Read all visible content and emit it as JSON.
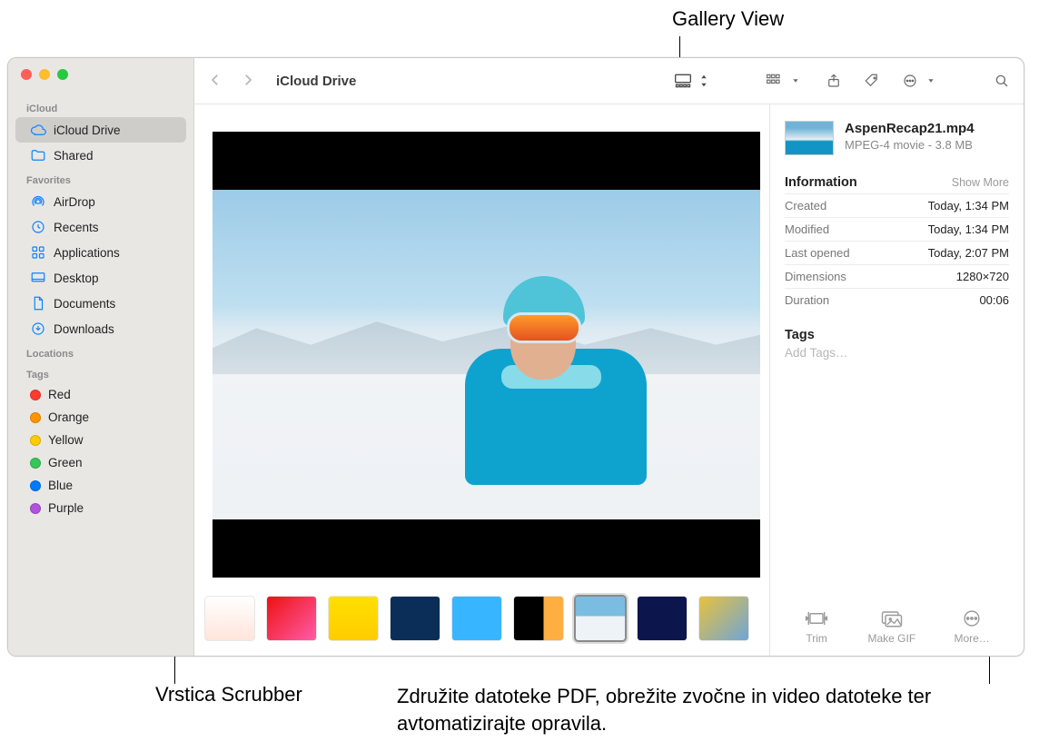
{
  "callouts": {
    "gallery_view": "Gallery View",
    "scrubber": "Vrstica Scrubber",
    "more": "Združite datoteke PDF, obrežite zvočne in video datoteke ter avtomatizirajte opravila."
  },
  "window_title": "iCloud Drive",
  "sidebar": {
    "sections": [
      {
        "header": "iCloud",
        "items": [
          {
            "icon": "cloud",
            "label": "iCloud Drive",
            "selected": true
          },
          {
            "icon": "shared-folder",
            "label": "Shared",
            "selected": false
          }
        ]
      },
      {
        "header": "Favorites",
        "items": [
          {
            "icon": "airdrop",
            "label": "AirDrop"
          },
          {
            "icon": "clock",
            "label": "Recents"
          },
          {
            "icon": "apps",
            "label": "Applications"
          },
          {
            "icon": "desktop",
            "label": "Desktop"
          },
          {
            "icon": "doc",
            "label": "Documents"
          },
          {
            "icon": "download",
            "label": "Downloads"
          }
        ]
      },
      {
        "header": "Locations",
        "items": []
      },
      {
        "header": "Tags",
        "items": [
          {
            "color": "#ff3b30",
            "label": "Red"
          },
          {
            "color": "#ff9500",
            "label": "Orange"
          },
          {
            "color": "#ffcc00",
            "label": "Yellow"
          },
          {
            "color": "#34c759",
            "label": "Green"
          },
          {
            "color": "#007aff",
            "label": "Blue"
          },
          {
            "color": "#af52de",
            "label": "Purple"
          }
        ]
      }
    ]
  },
  "info": {
    "filename": "AspenRecap21.mp4",
    "subtitle": "MPEG-4 movie - 3.8 MB",
    "information_header": "Information",
    "show_more": "Show More",
    "rows": [
      {
        "k": "Created",
        "v": "Today, 1:34 PM"
      },
      {
        "k": "Modified",
        "v": "Today, 1:34 PM"
      },
      {
        "k": "Last opened",
        "v": "Today, 2:07 PM"
      },
      {
        "k": "Dimensions",
        "v": "1280×720"
      },
      {
        "k": "Duration",
        "v": "00:06"
      }
    ],
    "tags_header": "Tags",
    "add_tags": "Add Tags…"
  },
  "quick_actions": {
    "trim": "Trim",
    "make_gif": "Make GIF",
    "more": "More…"
  },
  "thumbnails": [
    {
      "name": "thumb-1",
      "bg": "linear-gradient(180deg,#fff,#ffe5da)"
    },
    {
      "name": "thumb-2",
      "bg": "linear-gradient(135deg,#e11,#ff5caa)"
    },
    {
      "name": "thumb-3",
      "bg": "linear-gradient(180deg,#ffe000,#ffcc00)"
    },
    {
      "name": "thumb-4",
      "bg": "#0a2e57"
    },
    {
      "name": "thumb-5",
      "bg": "#37b6ff"
    },
    {
      "name": "thumb-6",
      "bg": "linear-gradient(90deg,#000 60%,#ffae42 60%)"
    },
    {
      "name": "thumb-7",
      "bg": "linear-gradient(180deg,#7abde0 45%,#eef3f7 45%)",
      "selected": true
    },
    {
      "name": "thumb-8",
      "bg": "#0d154d"
    },
    {
      "name": "thumb-9",
      "bg": "linear-gradient(135deg,#e7c23d,#6fa5d8)"
    }
  ]
}
